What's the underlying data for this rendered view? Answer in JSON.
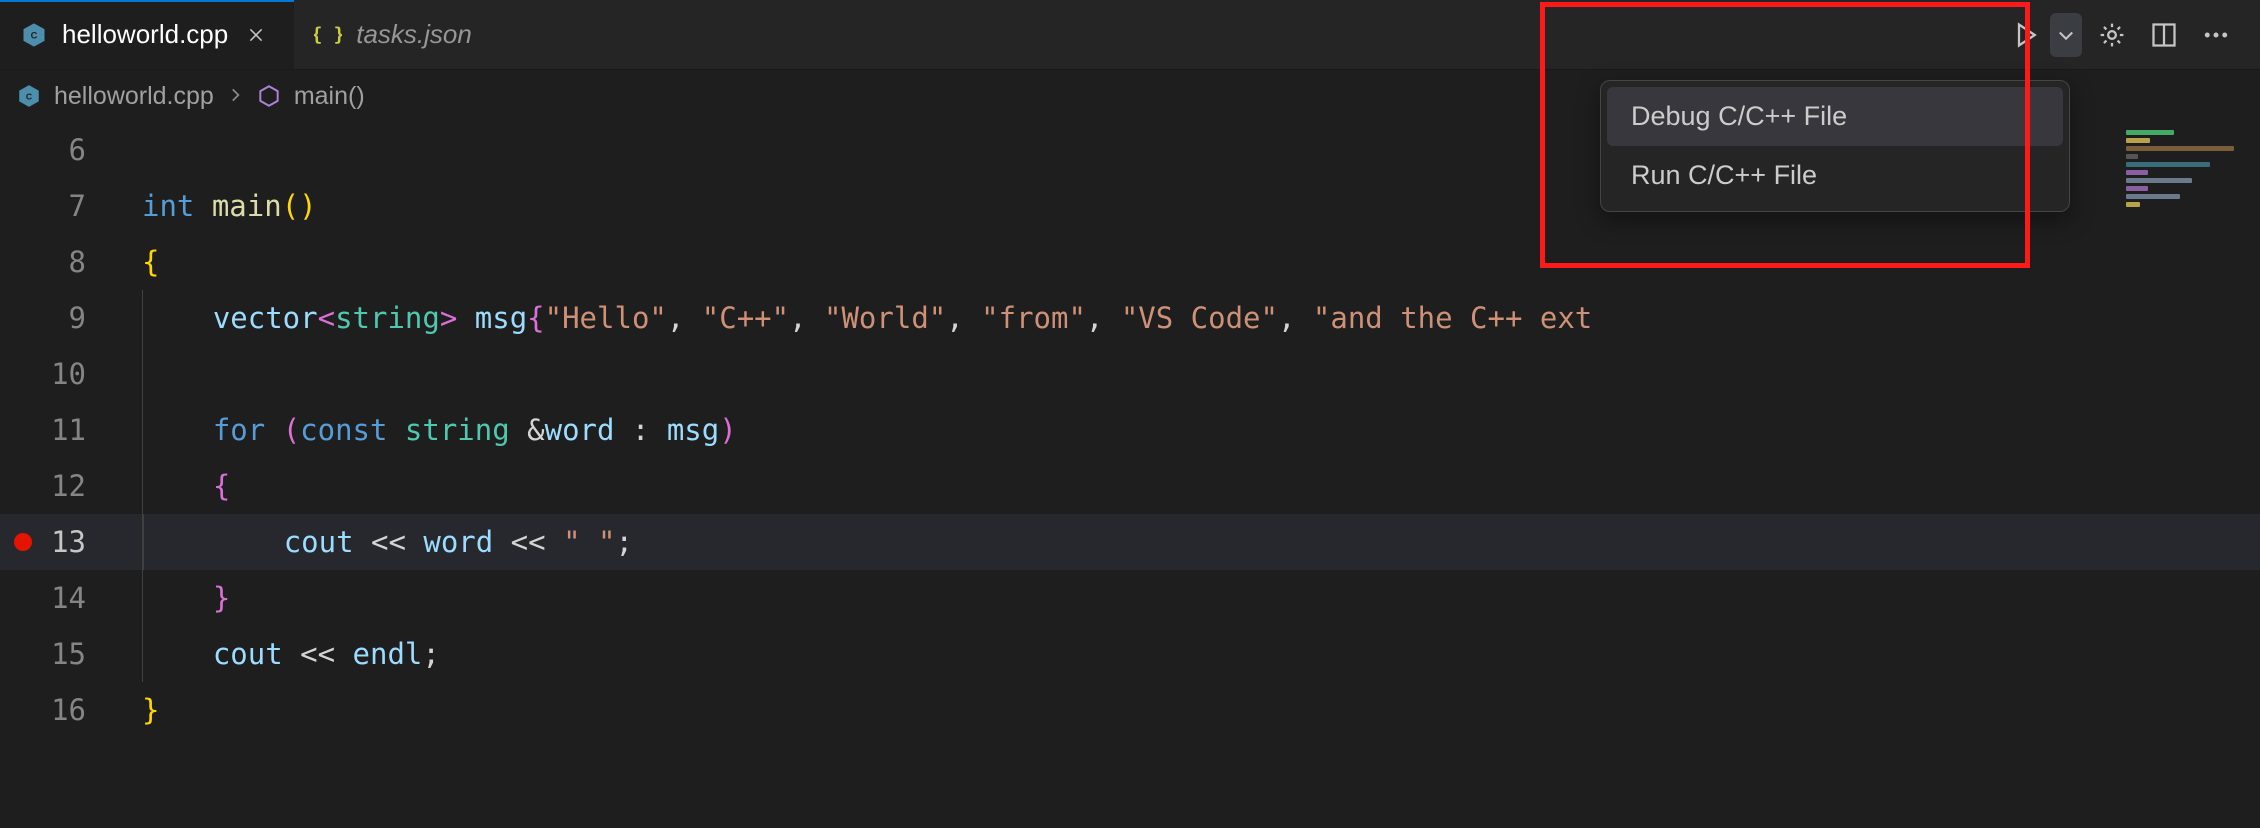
{
  "tabs": [
    {
      "label": "helloworld.cpp",
      "active": true,
      "italic": false,
      "iconColor": "#519aba",
      "iconText": "C++"
    },
    {
      "label": "tasks.json",
      "active": false,
      "italic": true,
      "iconColor": "#cbcb41",
      "iconText": "{ }"
    }
  ],
  "breadcrumb": {
    "file": "helloworld.cpp",
    "symbol": "main()"
  },
  "editor": {
    "startLine": 6,
    "currentLine": 13,
    "breakpointLine": 13,
    "lines": [
      {
        "n": 6,
        "indent": 0,
        "tokens": []
      },
      {
        "n": 7,
        "indent": 0,
        "tokens": [
          [
            "kw",
            "int "
          ],
          [
            "fn",
            "main"
          ],
          [
            "brace3",
            "()"
          ]
        ]
      },
      {
        "n": 8,
        "indent": 0,
        "tokens": [
          [
            "brace3",
            "{"
          ]
        ]
      },
      {
        "n": 9,
        "indent": 1,
        "tokens": [
          [
            "var",
            "vector"
          ],
          [
            "brace",
            "<"
          ],
          [
            "type",
            "string"
          ],
          [
            "brace",
            ">"
          ],
          [
            "punc",
            " "
          ],
          [
            "var",
            "msg"
          ],
          [
            "brace",
            "{"
          ],
          [
            "str",
            "\"Hello\""
          ],
          [
            "punc",
            ", "
          ],
          [
            "str",
            "\"C++\""
          ],
          [
            "punc",
            ", "
          ],
          [
            "str",
            "\"World\""
          ],
          [
            "punc",
            ", "
          ],
          [
            "str",
            "\"from\""
          ],
          [
            "punc",
            ", "
          ],
          [
            "str",
            "\"VS Code\""
          ],
          [
            "punc",
            ", "
          ],
          [
            "str",
            "\"and the C++ ext"
          ]
        ]
      },
      {
        "n": 10,
        "indent": 1,
        "tokens": []
      },
      {
        "n": 11,
        "indent": 1,
        "tokens": [
          [
            "kw",
            "for "
          ],
          [
            "brace",
            "("
          ],
          [
            "kw",
            "const "
          ],
          [
            "type",
            "string "
          ],
          [
            "op",
            "&"
          ],
          [
            "var",
            "word"
          ],
          [
            "punc",
            " : "
          ],
          [
            "var",
            "msg"
          ],
          [
            "brace",
            ")"
          ]
        ]
      },
      {
        "n": 12,
        "indent": 1,
        "tokens": [
          [
            "brace",
            "{"
          ]
        ]
      },
      {
        "n": 13,
        "indent": 2,
        "tokens": [
          [
            "var",
            "cout"
          ],
          [
            "op",
            " << "
          ],
          [
            "var",
            "word"
          ],
          [
            "op",
            " << "
          ],
          [
            "str",
            "\" \""
          ],
          [
            "punc",
            ";"
          ]
        ]
      },
      {
        "n": 14,
        "indent": 1,
        "tokens": [
          [
            "brace",
            "}"
          ]
        ]
      },
      {
        "n": 15,
        "indent": 1,
        "tokens": [
          [
            "var",
            "cout"
          ],
          [
            "op",
            " << "
          ],
          [
            "var",
            "endl"
          ],
          [
            "punc",
            ";"
          ]
        ]
      },
      {
        "n": 16,
        "indent": 0,
        "tokens": [
          [
            "brace3",
            "}"
          ]
        ]
      }
    ]
  },
  "dropdown": {
    "items": [
      {
        "label": "Debug C/C++ File",
        "focused": true
      },
      {
        "label": "Run C/C++ File",
        "focused": false
      }
    ]
  },
  "titleActions": {
    "run": "play-icon",
    "chevron": "chevron-down-icon",
    "settings": "gear-icon",
    "split": "split-editor-icon",
    "more": "more-icon"
  }
}
